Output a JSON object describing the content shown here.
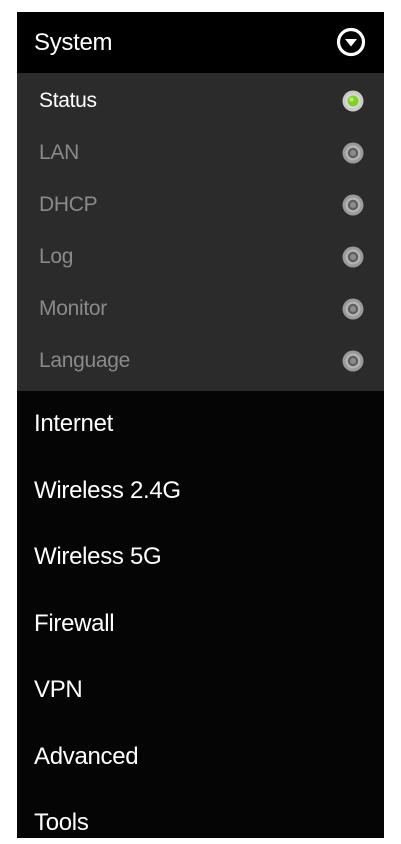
{
  "sidebar": {
    "expanded_section": {
      "label": "System",
      "toggle_icon": "chevron-down-circle-icon",
      "items": [
        {
          "label": "Status",
          "status": "active",
          "indicator_color": "#7ed321"
        },
        {
          "label": "LAN",
          "status": "inactive",
          "indicator_color": "#8c8c8c"
        },
        {
          "label": "DHCP",
          "status": "inactive",
          "indicator_color": "#8c8c8c"
        },
        {
          "label": "Log",
          "status": "inactive",
          "indicator_color": "#8c8c8c"
        },
        {
          "label": "Monitor",
          "status": "inactive",
          "indicator_color": "#8c8c8c"
        },
        {
          "label": "Language",
          "status": "inactive",
          "indicator_color": "#8c8c8c"
        }
      ]
    },
    "items": [
      {
        "label": "Internet"
      },
      {
        "label": "Wireless 2.4G"
      },
      {
        "label": "Wireless 5G"
      },
      {
        "label": "Firewall"
      },
      {
        "label": "VPN"
      },
      {
        "label": "Advanced"
      },
      {
        "label": "Tools"
      }
    ]
  },
  "colors": {
    "menu_background": "#050505",
    "submenu_background": "#2b2b2b",
    "active_text": "#ffffff",
    "inactive_text": "#8a8a8a",
    "active_indicator": "#7ed321",
    "inactive_indicator": "#8c8c8c"
  }
}
